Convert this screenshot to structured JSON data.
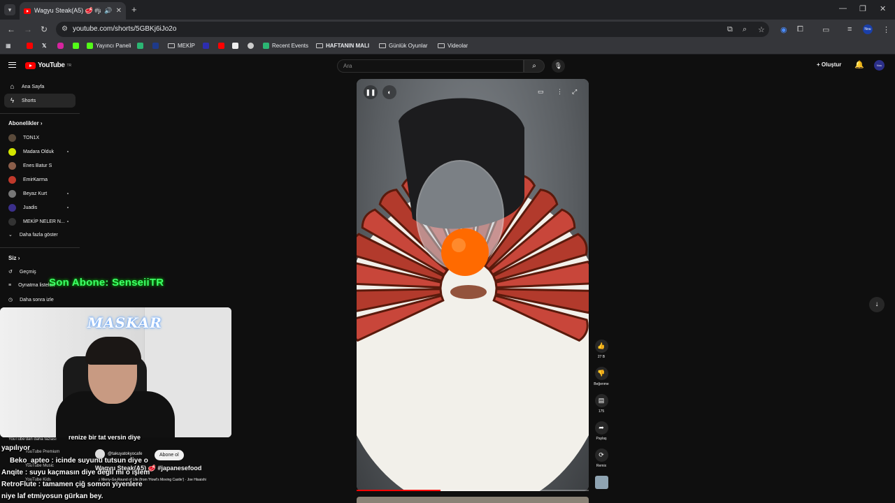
{
  "browser": {
    "tab_title": "Wagyu Steak(A5) 🥩 #japan",
    "url": "youtube.com/shorts/5GBKj6iJo2o",
    "bookmarks": [
      "Yayıncı Paneli",
      "MEKİP",
      "Recent Events",
      "HAFTANIN MALI",
      "Günlük Oyunlar",
      "Videolar"
    ],
    "profile_badge": "Nou"
  },
  "youtube": {
    "logo_text": "YouTube",
    "logo_region": "TR",
    "search_placeholder": "Ara",
    "create_label": "Oluştur",
    "avatar_text": "Nou"
  },
  "sidebar": {
    "home": "Ana Sayfa",
    "shorts": "Shorts",
    "subscriptions_header": "Abonelikler",
    "subscriptions": [
      "TON1X",
      "Madara Olduk",
      "Enes Batur S",
      "EmirKarma",
      "Beyaz Kurt",
      "Juadis",
      "MEKİP NELER N..."
    ],
    "show_more": "Daha fazla göster",
    "you_header": "Siz",
    "history": "Geçmiş",
    "playlists": "Oynatma listeleri",
    "watch_later": "Daha sonra izle",
    "premium": "YouTube Premium",
    "music": "YouTube Music",
    "kids": "YouTube Kids",
    "more_from": "YouTube'dan daha fazlası"
  },
  "stream_overlay": {
    "last_sub": "Son Abone: SenseiiTR",
    "cam_brand": "MASKAR",
    "chat": [
      "yapılıyor",
      "Beko_apteo : icinde suyunu tutsun diye o",
      "Anqite : suyu kaçmasın diye değil mi o işlem",
      "RetroFlute : tamamen çiğ somon yiyenlere",
      "niye laf etmiyosun gürkan bey."
    ],
    "chat_top_fragment": "renize bir tat versin diye"
  },
  "short": {
    "channel": "@takuyatokyocafe",
    "subscribe": "Abone ol",
    "title": "Wagyu Steak(A5) 🥩 #japanesefood",
    "music": "♫ Merry-Go-Round of Life (from 'Howl's Moving Castle') · Joe Hisaishi",
    "likes": "27 B",
    "dislike_label": "Beğenme",
    "comments": "175",
    "share_label": "Paylaş",
    "remix_label": "Remix",
    "progress": 0.36
  }
}
